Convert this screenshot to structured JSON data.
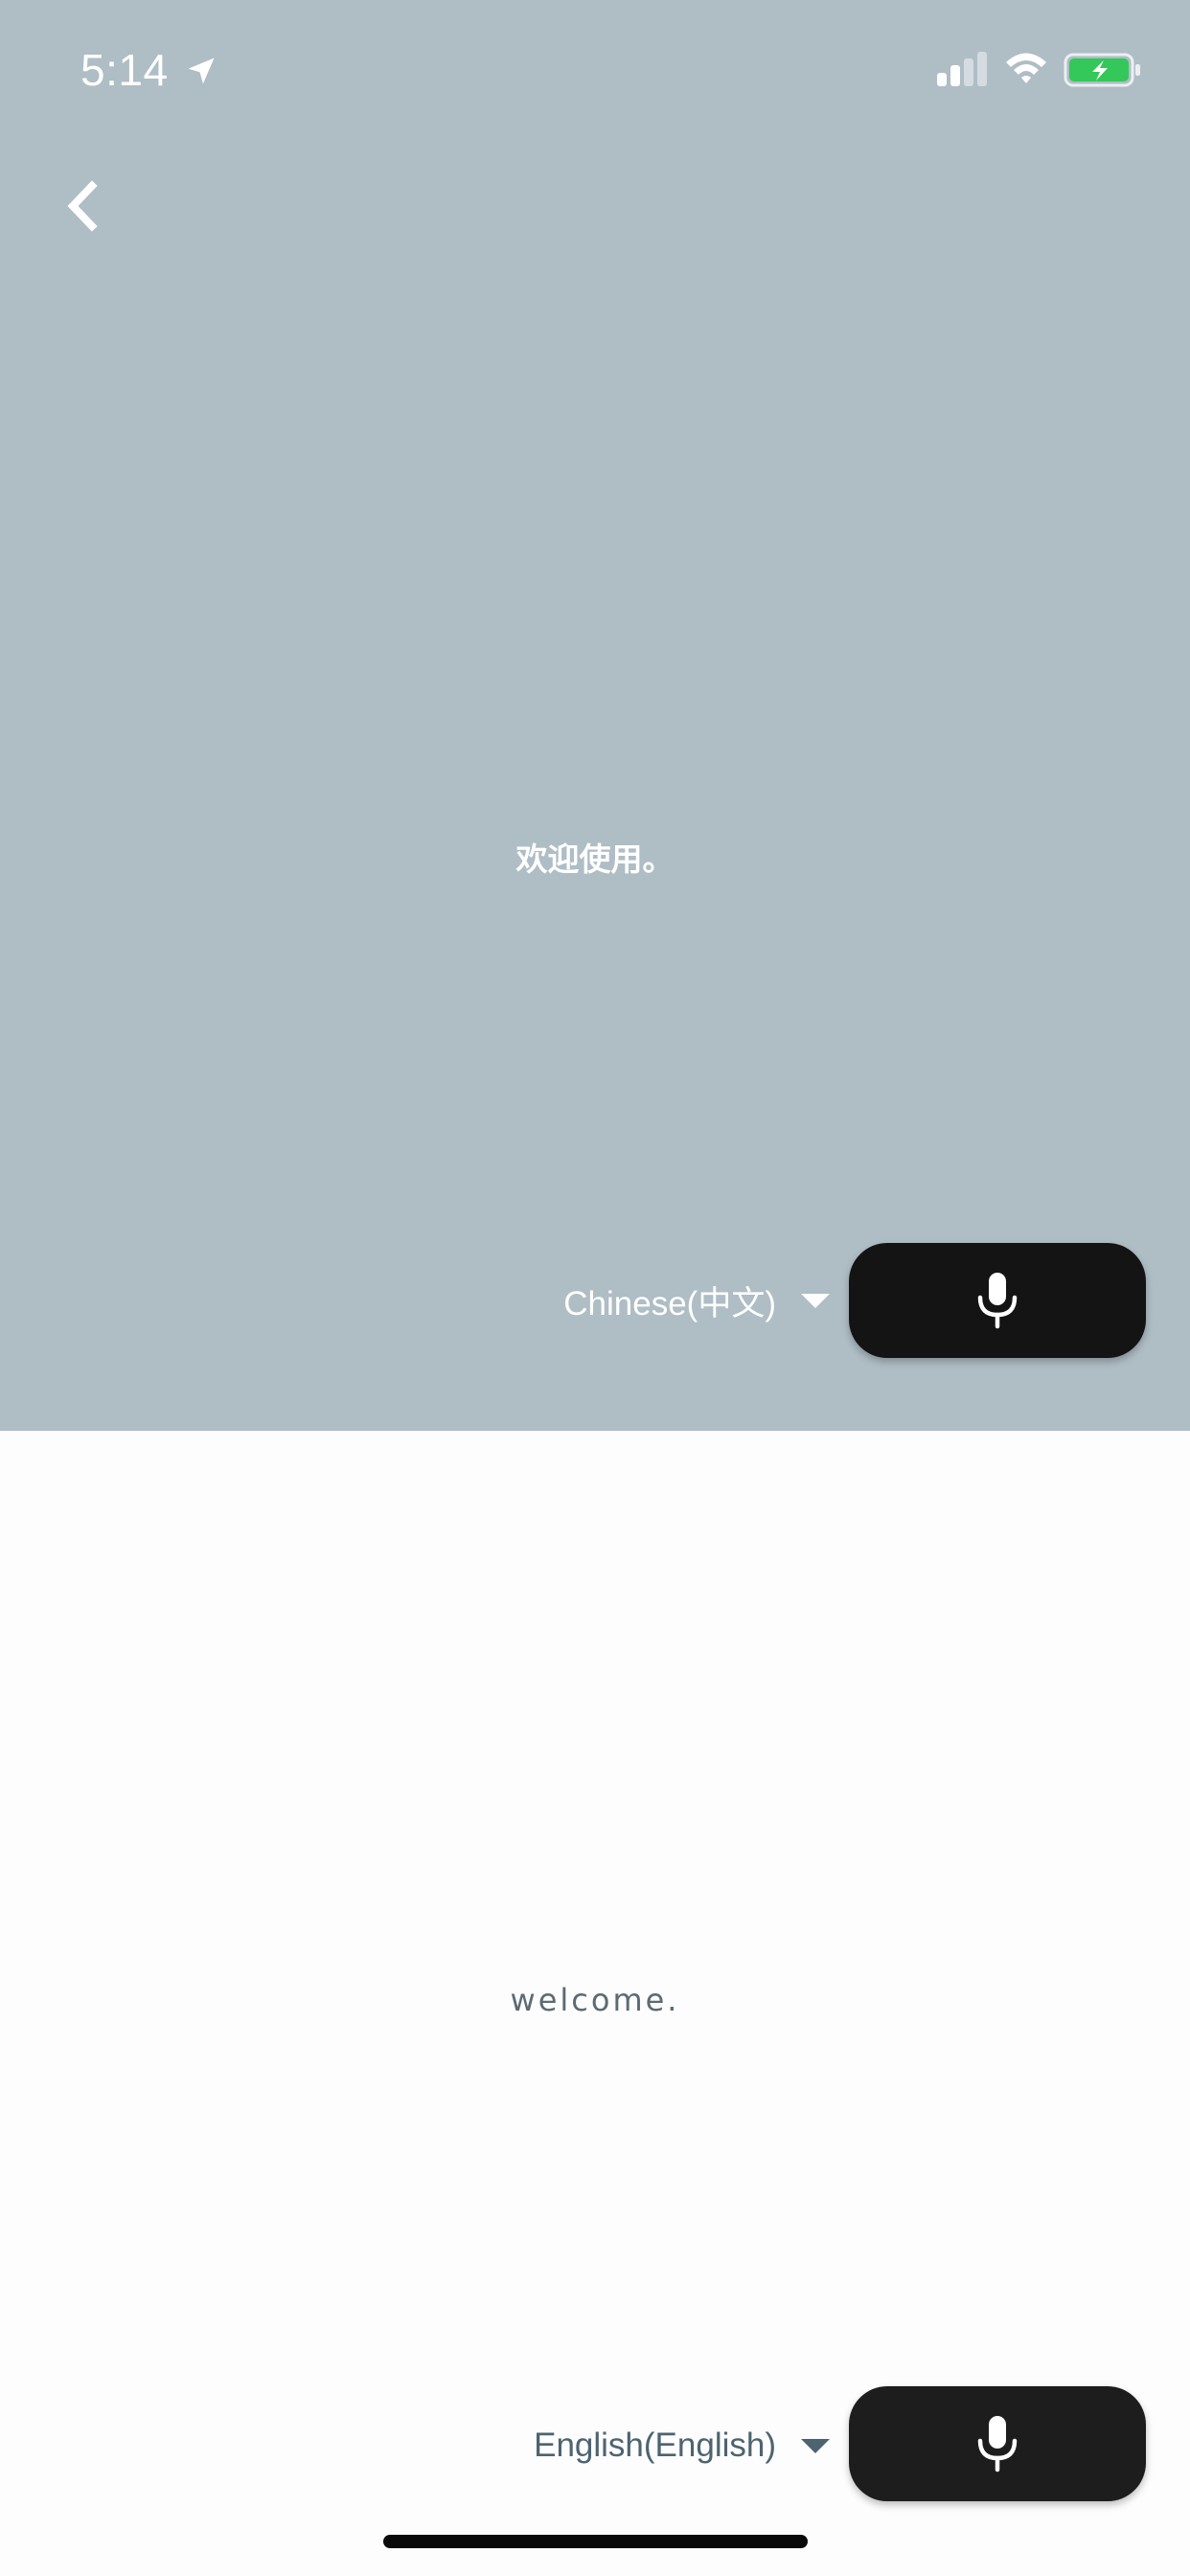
{
  "status_bar": {
    "time": "5:14",
    "icons": [
      "location-arrow-icon",
      "signal-icon",
      "wifi-icon",
      "battery-charging-icon"
    ],
    "battery_color": "#34c759"
  },
  "nav": {
    "back_icon": "chevron-left-icon"
  },
  "source": {
    "text": "欢迎使用。",
    "language": "Chinese(中文)",
    "pane_color": "#afbdc5"
  },
  "target": {
    "text": "welcome.",
    "language": "English(English)",
    "pane_color": "#fdfdfd"
  },
  "mic": {
    "icon": "microphone-icon",
    "button_color": "#141414"
  }
}
